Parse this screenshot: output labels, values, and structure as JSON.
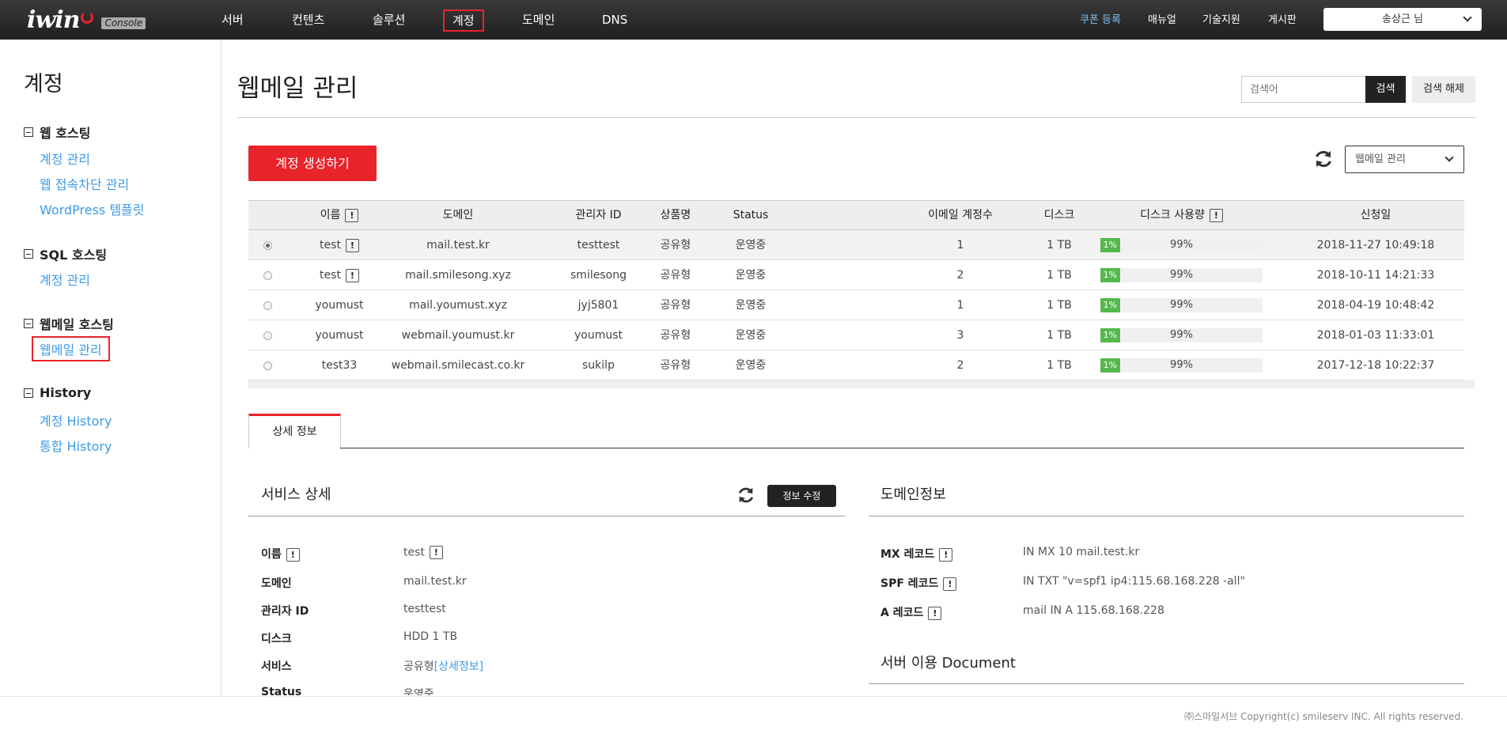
{
  "brand": {
    "name": "iwin",
    "badge": "Console"
  },
  "topnav": [
    {
      "label": "서버"
    },
    {
      "label": "컨텐츠"
    },
    {
      "label": "솔루션"
    },
    {
      "label": "계정"
    },
    {
      "label": "도메인"
    },
    {
      "label": "DNS"
    }
  ],
  "toplinks": {
    "coupon": "쿠폰 등록",
    "manual": "매뉴얼",
    "support": "기술지원",
    "board": "게시판"
  },
  "user": {
    "name": "송상근 님"
  },
  "sidebar": {
    "title": "계정",
    "groups": [
      {
        "label": "웹 호스팅",
        "items": [
          "계정 관리",
          "웹 접속차단 관리",
          "WordPress 템플릿"
        ]
      },
      {
        "label": "SQL 호스팅",
        "items": [
          "계정 관리"
        ]
      },
      {
        "label": "웹메일 호스팅",
        "items": [
          "웹메일 관리"
        ]
      },
      {
        "label": "History",
        "items": [
          "계정 History",
          "통합 History"
        ]
      }
    ]
  },
  "page": {
    "title": "웹메일 관리"
  },
  "search": {
    "placeholder": "검색어",
    "button": "검색",
    "reset": "검색 해제"
  },
  "actions": {
    "create": "계정 생성하기",
    "filter": "웹메일 관리"
  },
  "table": {
    "headers": [
      "이름",
      "도메인",
      "관리자 ID",
      "상품명",
      "Status",
      "이메일 계정수",
      "디스크",
      "디스크 사용량",
      "신청일"
    ],
    "rows": [
      {
        "name": "test",
        "domain": "mail.test.kr",
        "admin": "testtest",
        "product": "공유형",
        "status": "운영중",
        "count": "1",
        "disk": "1 TB",
        "used": "1%",
        "free": "99%",
        "used_fraction": 0.01,
        "date": "2018-11-27 10:49:18",
        "selected": true,
        "info": true
      },
      {
        "name": "test",
        "domain": "mail.smilesong.xyz",
        "admin": "smilesong",
        "product": "공유형",
        "status": "운영중",
        "count": "2",
        "disk": "1 TB",
        "used": "1%",
        "free": "99%",
        "used_fraction": 0.01,
        "date": "2018-10-11 14:21:33",
        "selected": false,
        "info": true
      },
      {
        "name": "youmust",
        "domain": "mail.youmust.xyz",
        "admin": "jyj5801",
        "product": "공유형",
        "status": "운영중",
        "count": "1",
        "disk": "1 TB",
        "used": "1%",
        "free": "99%",
        "used_fraction": 0.01,
        "date": "2018-04-19 10:48:42",
        "selected": false,
        "info": false
      },
      {
        "name": "youmust",
        "domain": "webmail.youmust.kr",
        "admin": "youmust",
        "product": "공유형",
        "status": "운영중",
        "count": "3",
        "disk": "1 TB",
        "used": "1%",
        "free": "99%",
        "used_fraction": 0.01,
        "date": "2018-01-03 11:33:01",
        "selected": false,
        "info": false
      },
      {
        "name": "test33",
        "domain": "webmail.smilecast.co.kr",
        "admin": "sukilp",
        "product": "공유형",
        "status": "운영중",
        "count": "2",
        "disk": "1 TB",
        "used": "1%",
        "free": "99%",
        "used_fraction": 0.01,
        "date": "2017-12-18 10:22:37",
        "selected": false,
        "info": false
      }
    ]
  },
  "tabs": {
    "detail": "상세 정보"
  },
  "service": {
    "title": "서비스 상세",
    "edit": "정보 수정",
    "fields": [
      {
        "label": "이름",
        "value": "test",
        "info": true
      },
      {
        "label": "도메인",
        "value": "mail.test.kr"
      },
      {
        "label": "관리자 ID",
        "value": "testtest"
      },
      {
        "label": "디스크",
        "value": "HDD 1 TB"
      },
      {
        "label": "서비스",
        "value": "공유형",
        "link": "[상세정보]"
      },
      {
        "label": "Status",
        "value": "운영중"
      }
    ]
  },
  "domaininfo": {
    "title": "도메인정보",
    "fields": [
      {
        "label": "MX 레코드",
        "value": "IN MX 10 mail.test.kr"
      },
      {
        "label": "SPF 레코드",
        "value": "IN TXT \"v=spf1 ip4:115.68.168.228 -all\""
      },
      {
        "label": "A 레코드",
        "value": "mail IN A 115.68.168.228"
      }
    ]
  },
  "document": {
    "title": "서버 이용 Document"
  },
  "footer": {
    "copyright": "㈜스마일서브 Copyright(c) smileserv INC. All rights reserved."
  },
  "colors": {
    "accent": "#e8232a",
    "link": "#3d9ae8",
    "bar": "#55b84e"
  }
}
